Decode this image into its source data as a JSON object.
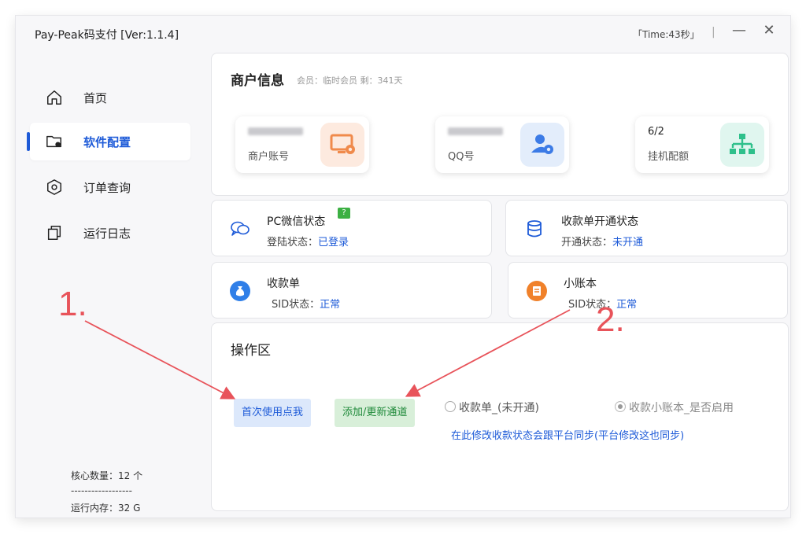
{
  "window": {
    "title": "Pay-Peak码支付  [Ver:1.1.4]",
    "timer": "「Time:43秒」",
    "separator": "|",
    "minimize": "—",
    "close": "✕"
  },
  "sidebar": {
    "items": [
      {
        "label": "首页",
        "icon": "home-icon"
      },
      {
        "label": "软件配置",
        "icon": "folder-settings-icon",
        "active": true
      },
      {
        "label": "订单查询",
        "icon": "hexagon-icon"
      },
      {
        "label": "运行日志",
        "icon": "copy-icon"
      }
    ],
    "stats": {
      "cores": "核心数量：12 个",
      "divider": "------------------",
      "memory": "运行内存：32 G"
    }
  },
  "merchant": {
    "title": "商户信息",
    "subtitle": "会员：临时会员  剩：341天",
    "boxes": [
      {
        "caption": "商户账号",
        "value": "",
        "icon": "monitor-gear-icon",
        "color": "#fdeadf",
        "iconColor": "#f08a4b"
      },
      {
        "caption": "QQ号",
        "value": "",
        "icon": "user-gear-icon",
        "color": "#e3edfb",
        "iconColor": "#3c7be6"
      },
      {
        "caption": "挂机配额",
        "value": "6/2",
        "icon": "org-tree-icon",
        "color": "#e0f6ef",
        "iconColor": "#2ec08b"
      }
    ]
  },
  "status": {
    "wechat": {
      "title": "PC微信状态",
      "help": "?",
      "label": "登陆状态：",
      "value": "已登录"
    },
    "order": {
      "title": "收款单开通状态",
      "label": "开通状态：",
      "value": "未开通"
    },
    "receipt": {
      "title": "收款单",
      "label": "SID状态：",
      "value": "正常"
    },
    "ledger": {
      "title": "小账本",
      "label": "SID状态：",
      "value": "正常"
    }
  },
  "ops": {
    "title": "操作区",
    "first_use_button": "首次使用点我",
    "add_channel_button": "添加/更新通道",
    "radio_receipt": "收款单_(未开通)",
    "radio_ledger": "收款小账本_是否启用",
    "note": "在此修改收款状态会跟平台同步(平台修改这也同步)"
  },
  "annotations": {
    "one": "1.",
    "two": "2."
  },
  "colors": {
    "accent": "#1e5bd8",
    "annotation": "#e8535a"
  }
}
